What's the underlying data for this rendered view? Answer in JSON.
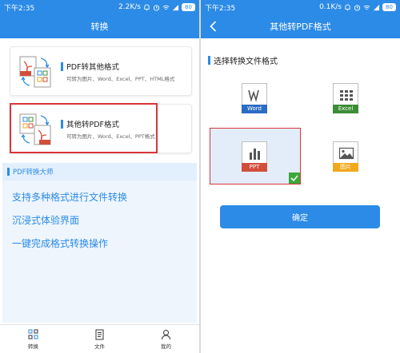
{
  "left": {
    "status": {
      "time": "下午2:35",
      "speed": "2.2K/s",
      "battery": "80"
    },
    "title": "转换",
    "cards": [
      {
        "title": "PDF转其他格式",
        "subtitle": "可转为图片、Word、Excel、PPT、HTML格式"
      },
      {
        "title": "其他转PDF格式",
        "subtitle": "可转为图片、Word、Excel、PPT格式"
      }
    ],
    "promo": {
      "title": "PDF转换大师",
      "lines": [
        "支持多种格式进行文件转换",
        "沉浸式体验界面",
        "一键完成格式转换操作"
      ]
    },
    "tabs": [
      {
        "label": "转换",
        "icon": "scan-convert-icon"
      },
      {
        "label": "文件",
        "icon": "document-icon"
      },
      {
        "label": "我的",
        "icon": "person-icon"
      }
    ]
  },
  "right": {
    "status": {
      "time": "下午2:35",
      "speed": "0.1K/s",
      "battery": "80"
    },
    "title": "其他转PDF格式",
    "section_title": "选择转换文件格式",
    "formats": [
      {
        "label": "Word",
        "color": "#2b6cc4",
        "icon": "word-icon"
      },
      {
        "label": "Excel",
        "color": "#3d8c36",
        "icon": "excel-icon"
      },
      {
        "label": "PPT",
        "color": "#d24e3c",
        "icon": "ppt-icon"
      },
      {
        "label": "图片",
        "color": "#f0a91c",
        "icon": "image-icon"
      }
    ],
    "selected_format": "PPT",
    "confirm": "确定"
  },
  "colors": {
    "primary": "#2c8be6",
    "highlight": "#d9343b",
    "check": "#3aa93a"
  }
}
